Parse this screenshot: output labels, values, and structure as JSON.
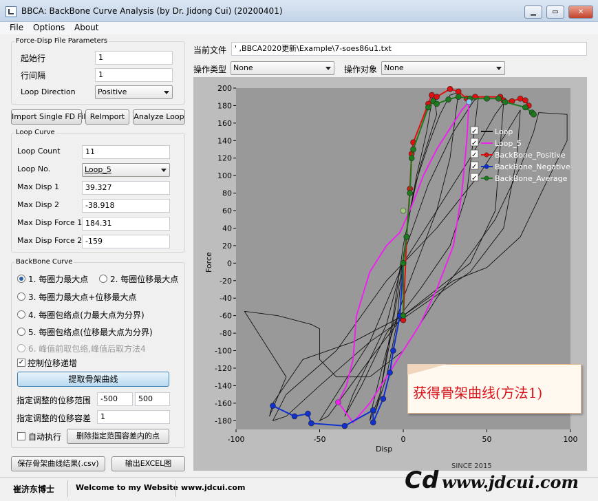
{
  "window": {
    "title": "BBCA: BackBone Curve Analysis (by Dr. Jidong Cui) (20200401)",
    "min_label": "▁",
    "max_label": "▭",
    "close_label": "✕"
  },
  "menu": [
    "File",
    "Options",
    "About"
  ],
  "force_disp": {
    "title": "Force-Disp File Parameters",
    "start_row_label": "起始行",
    "start_row_value": "1",
    "row_interval_label": "行间隔",
    "row_interval_value": "1",
    "loop_dir_label": "Loop Direction",
    "loop_dir_value": "Positive"
  },
  "buttons": {
    "import": "Import Single FD File",
    "reimport": "ReImport",
    "analyze": "Analyze Loop",
    "extract": "提取骨架曲线",
    "delete_pts": "删除指定范围容差内的点",
    "save_csv": "保存骨架曲线结果(.csv)",
    "export_excel": "输出EXCEL图"
  },
  "loop_curve": {
    "title": "Loop Curve",
    "rows": [
      {
        "label": "Loop Count",
        "value": "11",
        "combo": false
      },
      {
        "label": "Loop No.",
        "value": "Loop_5",
        "combo": true
      },
      {
        "label": "Max Disp 1",
        "value": "39.327",
        "combo": false
      },
      {
        "label": "Max Disp 2",
        "value": "-38.918",
        "combo": false
      },
      {
        "label": "Max Disp Force 1",
        "value": "184.31",
        "combo": false
      },
      {
        "label": "Max Disp Force 2",
        "value": "-159",
        "combo": false
      }
    ]
  },
  "backbone": {
    "title": "BackBone Curve",
    "opt1": "1. 每圈力最大点",
    "opt2": "2. 每圈位移最大点",
    "opt3": "3. 每圈力最大点+位移最大点",
    "opt4": "4. 每圈包络点(力最大点为分界)",
    "opt5": "5. 每圈包络点(位移最大点为分界)",
    "opt6": "6. 峰值前取包络,峰值后取方法4",
    "control_label": "控制位移递增",
    "range_label": "指定调整的位移范围",
    "range_min": "-500",
    "range_max": "500",
    "tol_label": "指定调整的位移容差",
    "tol_value": "1",
    "auto_label": "自动执行"
  },
  "file_bar": {
    "label": "当前文件",
    "path": "'                              ,BBCA2020更新\\Example\\7-soes86u1.txt",
    "op_type_label": "操作类型",
    "op_type_value": "None",
    "op_target_label": "操作对象",
    "op_target_value": "None"
  },
  "status": {
    "author": "崔济东博士",
    "welcome": "Welcome to my Website",
    "url": "www.jdcui.com"
  },
  "callout": "获得骨架曲线(方法1)",
  "logo": {
    "mark": "Cd",
    "url": "www.jdcui.com",
    "since": "SINCE 2015"
  },
  "colors": {
    "loop": "#111111",
    "loop5": "#ee22ee",
    "positive": "#e01010",
    "negative": "#1030d0",
    "average": "#1b7a1b",
    "plot_bg": "#999999",
    "panel_bg": "#bdbdbd"
  },
  "chart_data": {
    "type": "line",
    "xlabel": "Disp",
    "ylabel": "Force",
    "xlim": [
      -100,
      100
    ],
    "ylim": [
      -190,
      200
    ],
    "xticks": [
      -100,
      -50,
      0,
      50,
      100
    ],
    "yticks": [
      -180,
      -160,
      -140,
      -120,
      -100,
      -80,
      -60,
      -40,
      -20,
      0,
      20,
      40,
      60,
      80,
      100,
      120,
      140,
      160,
      180,
      200
    ],
    "legend_position": "top-right",
    "series": [
      {
        "name": "Loop",
        "color": "#111111",
        "loops": [
          [
            [
              -2,
              -30
            ],
            [
              3,
              50
            ],
            [
              8,
              100
            ],
            [
              14,
              150
            ],
            [
              18,
              195
            ],
            [
              20,
              170
            ],
            [
              10,
              110
            ],
            [
              4,
              60
            ],
            [
              -2,
              -20
            ],
            [
              -8,
              -90
            ],
            [
              -14,
              -150
            ],
            [
              -17,
              -172
            ],
            [
              -10,
              -130
            ],
            [
              -4,
              -70
            ],
            [
              -2,
              -30
            ]
          ],
          [
            [
              -6,
              -60
            ],
            [
              0,
              20
            ],
            [
              8,
              95
            ],
            [
              15,
              135
            ],
            [
              22,
              170
            ],
            [
              28,
              192
            ],
            [
              33,
              195
            ],
            [
              28,
              120
            ],
            [
              20,
              60
            ],
            [
              10,
              10
            ],
            [
              0,
              -40
            ],
            [
              -10,
              -100
            ],
            [
              -18,
              -160
            ],
            [
              -20,
              -180
            ],
            [
              -14,
              -150
            ],
            [
              -6,
              -60
            ]
          ],
          [
            [
              -10,
              -70
            ],
            [
              2,
              20
            ],
            [
              15,
              90
            ],
            [
              30,
              150
            ],
            [
              42,
              185
            ],
            [
              45,
              190
            ],
            [
              38,
              80
            ],
            [
              28,
              20
            ],
            [
              10,
              -30
            ],
            [
              -10,
              -80
            ],
            [
              -25,
              -140
            ],
            [
              -35,
              -175
            ],
            [
              -30,
              -150
            ],
            [
              -10,
              -70
            ]
          ],
          [
            [
              -20,
              -90
            ],
            [
              0,
              0
            ],
            [
              20,
              60
            ],
            [
              40,
              120
            ],
            [
              55,
              170
            ],
            [
              60,
              183
            ],
            [
              55,
              60
            ],
            [
              40,
              0
            ],
            [
              20,
              -30
            ],
            [
              0,
              -60
            ],
            [
              -20,
              -110
            ],
            [
              -45,
              -175
            ],
            [
              -50,
              -180
            ],
            [
              -40,
              -150
            ],
            [
              -20,
              -90
            ]
          ],
          [
            [
              -40,
              -100
            ],
            [
              -10,
              -20
            ],
            [
              20,
              40
            ],
            [
              45,
              100
            ],
            [
              62,
              150
            ],
            [
              70,
              175
            ],
            [
              68,
              120
            ],
            [
              60,
              40
            ],
            [
              40,
              -10
            ],
            [
              10,
              -50
            ],
            [
              -20,
              -90
            ],
            [
              -50,
              -140
            ],
            [
              -70,
              -175
            ],
            [
              -78,
              -180
            ],
            [
              -70,
              -150
            ],
            [
              -40,
              -100
            ]
          ],
          [
            [
              -95,
              -55
            ],
            [
              -75,
              -60
            ],
            [
              -55,
              -70
            ],
            [
              -50,
              -75
            ],
            [
              -50,
              -110
            ],
            [
              -40,
              -130
            ],
            [
              -20,
              -130
            ],
            [
              0,
              -100
            ],
            [
              20,
              -40
            ],
            [
              40,
              10
            ],
            [
              55,
              50
            ],
            [
              70,
              110
            ],
            [
              78,
              150
            ],
            [
              81,
              172
            ],
            [
              98,
              170
            ],
            [
              98,
              140
            ],
            [
              85,
              90
            ],
            [
              70,
              30
            ],
            [
              50,
              -5
            ],
            [
              30,
              -20
            ],
            [
              0,
              -60
            ],
            [
              -30,
              -90
            ],
            [
              -60,
              -110
            ],
            [
              -78,
              -160
            ],
            [
              -80,
              -175
            ],
            [
              -70,
              -130
            ],
            [
              -95,
              -55
            ]
          ]
        ]
      },
      {
        "name": "Loop_5",
        "color": "#ee22ee",
        "points": [
          [
            -38.9,
            -159
          ],
          [
            -34,
            -140
          ],
          [
            -30,
            -110
          ],
          [
            -28,
            -60
          ],
          [
            -20,
            -10
          ],
          [
            -10,
            20
          ],
          [
            -2,
            35
          ],
          [
            5,
            65
          ],
          [
            12,
            100
          ],
          [
            20,
            130
          ],
          [
            30,
            160
          ],
          [
            35,
            175
          ],
          [
            39.3,
            184.3
          ],
          [
            38,
            140
          ],
          [
            35,
            80
          ],
          [
            30,
            20
          ],
          [
            20,
            -30
          ],
          [
            10,
            -70
          ],
          [
            0,
            -100
          ],
          [
            -10,
            -130
          ],
          [
            -20,
            -160
          ],
          [
            -30,
            -182
          ],
          [
            -38.9,
            -159
          ]
        ]
      },
      {
        "name": "BackBone_Positive",
        "color": "#e01010",
        "points": [
          [
            0,
            -65
          ],
          [
            2,
            30
          ],
          [
            4,
            85
          ],
          [
            5,
            125
          ],
          [
            6,
            138
          ],
          [
            15,
            182
          ],
          [
            17,
            192
          ],
          [
            20,
            190
          ],
          [
            28,
            199
          ],
          [
            33,
            196
          ],
          [
            38,
            188
          ],
          [
            43,
            190
          ],
          [
            58,
            190
          ],
          [
            60,
            186
          ],
          [
            65,
            185
          ],
          [
            70,
            188
          ],
          [
            73,
            186
          ],
          [
            75,
            180
          ]
        ]
      },
      {
        "name": "BackBone_Negative",
        "color": "#1030d0",
        "points": [
          [
            -78,
            -163
          ],
          [
            -65,
            -175
          ],
          [
            -57,
            -172
          ],
          [
            -55,
            -183
          ],
          [
            -35,
            -186
          ],
          [
            -18,
            -168
          ],
          [
            -18,
            -182
          ],
          [
            -12,
            -155
          ],
          [
            -8,
            -125
          ],
          [
            -6,
            -100
          ],
          [
            -2,
            -60
          ],
          [
            0,
            0
          ]
        ]
      },
      {
        "name": "BackBone_Average",
        "color": "#1b7a1b",
        "points": [
          [
            0,
            -60
          ],
          [
            0,
            0
          ],
          [
            2,
            30
          ],
          [
            4,
            80
          ],
          [
            5,
            120
          ],
          [
            6,
            130
          ],
          [
            15,
            178
          ],
          [
            18,
            185
          ],
          [
            20,
            182
          ],
          [
            27,
            187
          ],
          [
            33,
            190
          ],
          [
            40,
            188
          ],
          [
            50,
            188
          ],
          [
            57,
            188
          ],
          [
            61,
            184
          ],
          [
            73,
            178
          ],
          [
            77,
            172
          ],
          [
            78,
            170
          ]
        ]
      }
    ],
    "markers": [
      {
        "x": 0,
        "y": 60,
        "color": "#9cc97a"
      },
      {
        "x": 39.3,
        "y": 184.3,
        "color": "#8ec8f0"
      },
      {
        "x": -38.9,
        "y": -159,
        "color": "#ee22ee"
      }
    ]
  }
}
